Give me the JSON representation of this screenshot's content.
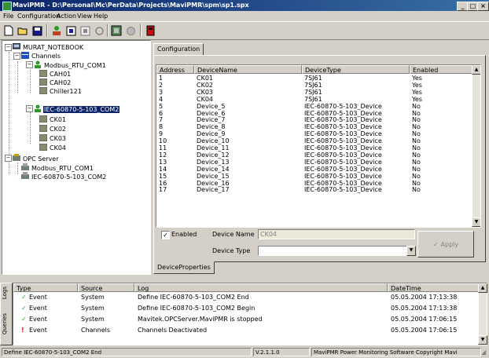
{
  "window": {
    "title": "MaviPMR - D:\\Personal\\Mc\\PerData\\Projects\\MaviPMR\\spm\\sp1.spx",
    "minimize": "_",
    "maximize": "□",
    "close": "×"
  },
  "menu": [
    "File",
    "Configuration",
    "Action",
    "View",
    "Help"
  ],
  "toolbar": [
    "new-icon",
    "open-icon",
    "save-icon",
    "user-icon",
    "module-icon",
    "module2-icon",
    "refresh-icon",
    "settings-icon",
    "disabled-icon",
    "stop-icon"
  ],
  "tree": {
    "root": "MURAT_NOTEBOOK",
    "channels": "Channels",
    "modbus": "Modbus_RTU_COM1",
    "modbus_items": [
      "CAH01",
      "CAH02",
      "Chiller121"
    ],
    "iec": "IEC-60870-5-103_COM2",
    "iec_items": [
      "CK01",
      "CK02",
      "CK03",
      "CK04"
    ],
    "opc": "OPC Server",
    "opc_items": [
      "Modbus_RTU_COM1",
      "IEC-60870-5-103_COM2"
    ]
  },
  "tabs": {
    "top": "Configuration",
    "bottom": "DeviceProperties"
  },
  "grid": {
    "headers": [
      "Address",
      "DeviceName",
      "DeviceType",
      "Enabled"
    ],
    "rows": [
      [
        "1",
        "CK01",
        "7SJ61",
        "Yes"
      ],
      [
        "2",
        "CK02",
        "7SJ61",
        "Yes"
      ],
      [
        "3",
        "CK03",
        "7SJ61",
        "Yes"
      ],
      [
        "4",
        "CK04",
        "7SJ61",
        "Yes"
      ],
      [
        "5",
        "Device_5",
        "IEC-60870-5-103_Device",
        "No"
      ],
      [
        "6",
        "Device_6",
        "IEC-60870-5-103_Device",
        "No"
      ],
      [
        "7",
        "Device_7",
        "IEC-60870-5-103_Device",
        "No"
      ],
      [
        "8",
        "Device_8",
        "IEC-60870-5-103_Device",
        "No"
      ],
      [
        "9",
        "Device_9",
        "IEC-60870-5-103_Device",
        "No"
      ],
      [
        "10",
        "Device_10",
        "IEC-60870-5-103_Device",
        "No"
      ],
      [
        "11",
        "Device_11",
        "IEC-60870-5-103_Device",
        "No"
      ],
      [
        "12",
        "Device_12",
        "IEC-60870-5-103_Device",
        "No"
      ],
      [
        "13",
        "Device_13",
        "IEC-60870-5-103_Device",
        "No"
      ],
      [
        "14",
        "Device_14",
        "IEC-60870-5-103_Device",
        "No"
      ],
      [
        "15",
        "Device_15",
        "IEC-60870-5-103_Device",
        "No"
      ],
      [
        "16",
        "Device_16",
        "IEC-60870-5-103_Device",
        "No"
      ],
      [
        "17",
        "Device_17",
        "IEC-60870-5-103_Device",
        "No"
      ]
    ]
  },
  "props": {
    "enabled_label": "Enabled",
    "enabled_checked": true,
    "device_name_label": "Device Name",
    "device_name_value": "CK04",
    "device_type_label": "Device Type",
    "device_type_value": "",
    "apply_label": "Apply"
  },
  "log": {
    "side_tabs": [
      "Logs",
      "Queries"
    ],
    "headers": [
      "Type",
      "Source",
      "Log",
      "DateTime"
    ],
    "rows": [
      {
        "type": "Event",
        "status": "ok",
        "source": "System",
        "log": "Define IEC-60870-5-103_COM2 End",
        "datetime": "05.05.2004 17:13:38"
      },
      {
        "type": "Event",
        "status": "ok",
        "source": "System",
        "log": "Define IEC-60870-5-103_COM2 Begin",
        "datetime": "05.05.2004 17:13:38"
      },
      {
        "type": "Event",
        "status": "ok",
        "source": "System",
        "log": "Mavitek.OPCServer.MaviPMR is stopped",
        "datetime": "05.05.2004 17:06:15"
      },
      {
        "type": "Event",
        "status": "warn",
        "source": "Channels",
        "log": "Channels Deactivated",
        "datetime": "05.05.2004 17:06:15"
      }
    ]
  },
  "statusbar": {
    "message": "Define IEC-60870-5-103_COM2 End",
    "version": "V.2.1.1.0",
    "copyright": "MaviPMR Power Monitoring Software Copyright Mavi"
  },
  "colors": {
    "selection": "#0a246a",
    "ok_icon": "#2e9a2e",
    "warn_icon": "#d01010"
  }
}
